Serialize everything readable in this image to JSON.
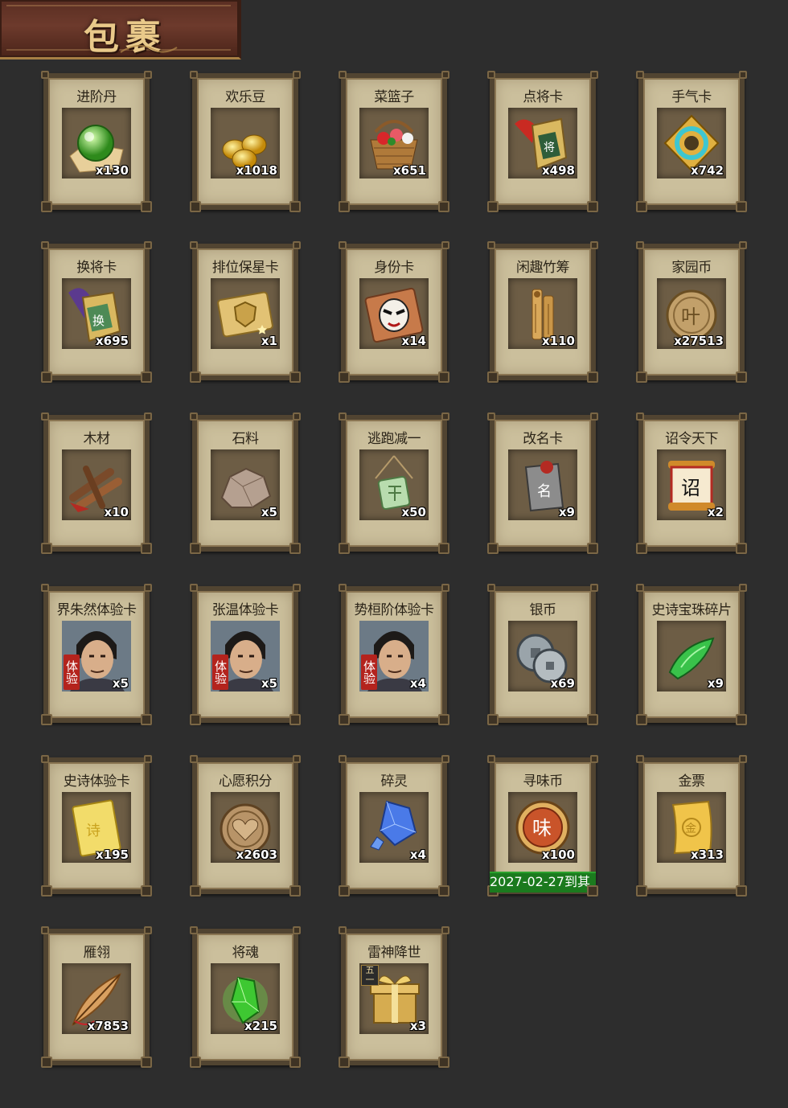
{
  "header": {
    "title": "包裹"
  },
  "items": [
    {
      "label": "进阶丹",
      "qty": "x130",
      "icon": "green-orb-icon"
    },
    {
      "label": "欢乐豆",
      "qty": "x1018",
      "icon": "gold-beans-icon"
    },
    {
      "label": "菜篮子",
      "qty": "x651",
      "icon": "flower-basket-icon"
    },
    {
      "label": "点将卡",
      "qty": "x498",
      "icon": "general-token-icon"
    },
    {
      "label": "手气卡",
      "qty": "x742",
      "icon": "luck-ring-icon"
    },
    {
      "label": "换将卡",
      "qty": "x695",
      "icon": "swap-token-icon"
    },
    {
      "label": "排位保星卡",
      "qty": "x1",
      "icon": "shield-card-icon"
    },
    {
      "label": "身份卡",
      "qty": "x14",
      "icon": "mask-card-icon"
    },
    {
      "label": "闲趣竹筹",
      "qty": "x110",
      "icon": "bamboo-tally-icon"
    },
    {
      "label": "家园币",
      "qty": "x27513",
      "icon": "home-coin-icon"
    },
    {
      "label": "木材",
      "qty": "x10",
      "icon": "wood-icon"
    },
    {
      "label": "石料",
      "qty": "x5",
      "icon": "stone-icon"
    },
    {
      "label": "逃跑减一",
      "qty": "x50",
      "icon": "jade-pendant-icon"
    },
    {
      "label": "改名卡",
      "qty": "x9",
      "icon": "rename-token-icon"
    },
    {
      "label": "诏令天下",
      "qty": "x2",
      "icon": "edict-scroll-icon"
    },
    {
      "label": "界朱然体验卡",
      "qty": "x5",
      "icon": "hero-portrait-icon",
      "badge": "体验"
    },
    {
      "label": "张温体验卡",
      "qty": "x5",
      "icon": "hero-portrait-icon",
      "badge": "体验"
    },
    {
      "label": "势桓阶体验卡",
      "qty": "x4",
      "icon": "hero-portrait-icon",
      "badge": "体验"
    },
    {
      "label": "银币",
      "qty": "x69",
      "icon": "silver-coins-icon"
    },
    {
      "label": "史诗宝珠碎片",
      "qty": "x9",
      "icon": "green-shard-icon"
    },
    {
      "label": "史诗体验卡",
      "qty": "x195",
      "icon": "gold-card-icon"
    },
    {
      "label": "心愿积分",
      "qty": "x2603",
      "icon": "heart-coin-icon"
    },
    {
      "label": "碎灵",
      "qty": "x4",
      "icon": "blue-crystal-icon"
    },
    {
      "label": "寻味币",
      "qty": "x100",
      "icon": "flavor-coin-icon",
      "expiry": "2027-02-27到其"
    },
    {
      "label": "金票",
      "qty": "x313",
      "icon": "gold-ticket-icon"
    },
    {
      "label": "雁翎",
      "qty": "x7853",
      "icon": "feather-icon"
    },
    {
      "label": "将魂",
      "qty": "x215",
      "icon": "green-soul-icon"
    },
    {
      "label": "雷神降世",
      "qty": "x3",
      "icon": "gift-box-icon",
      "gift_badge": "五一"
    }
  ],
  "colors": {
    "background": "#2d2d2d",
    "card": "#cbbf9c",
    "card_frame": "#514431",
    "header": "#6d3a2c",
    "expiry_bar": "#1b7a1e"
  }
}
